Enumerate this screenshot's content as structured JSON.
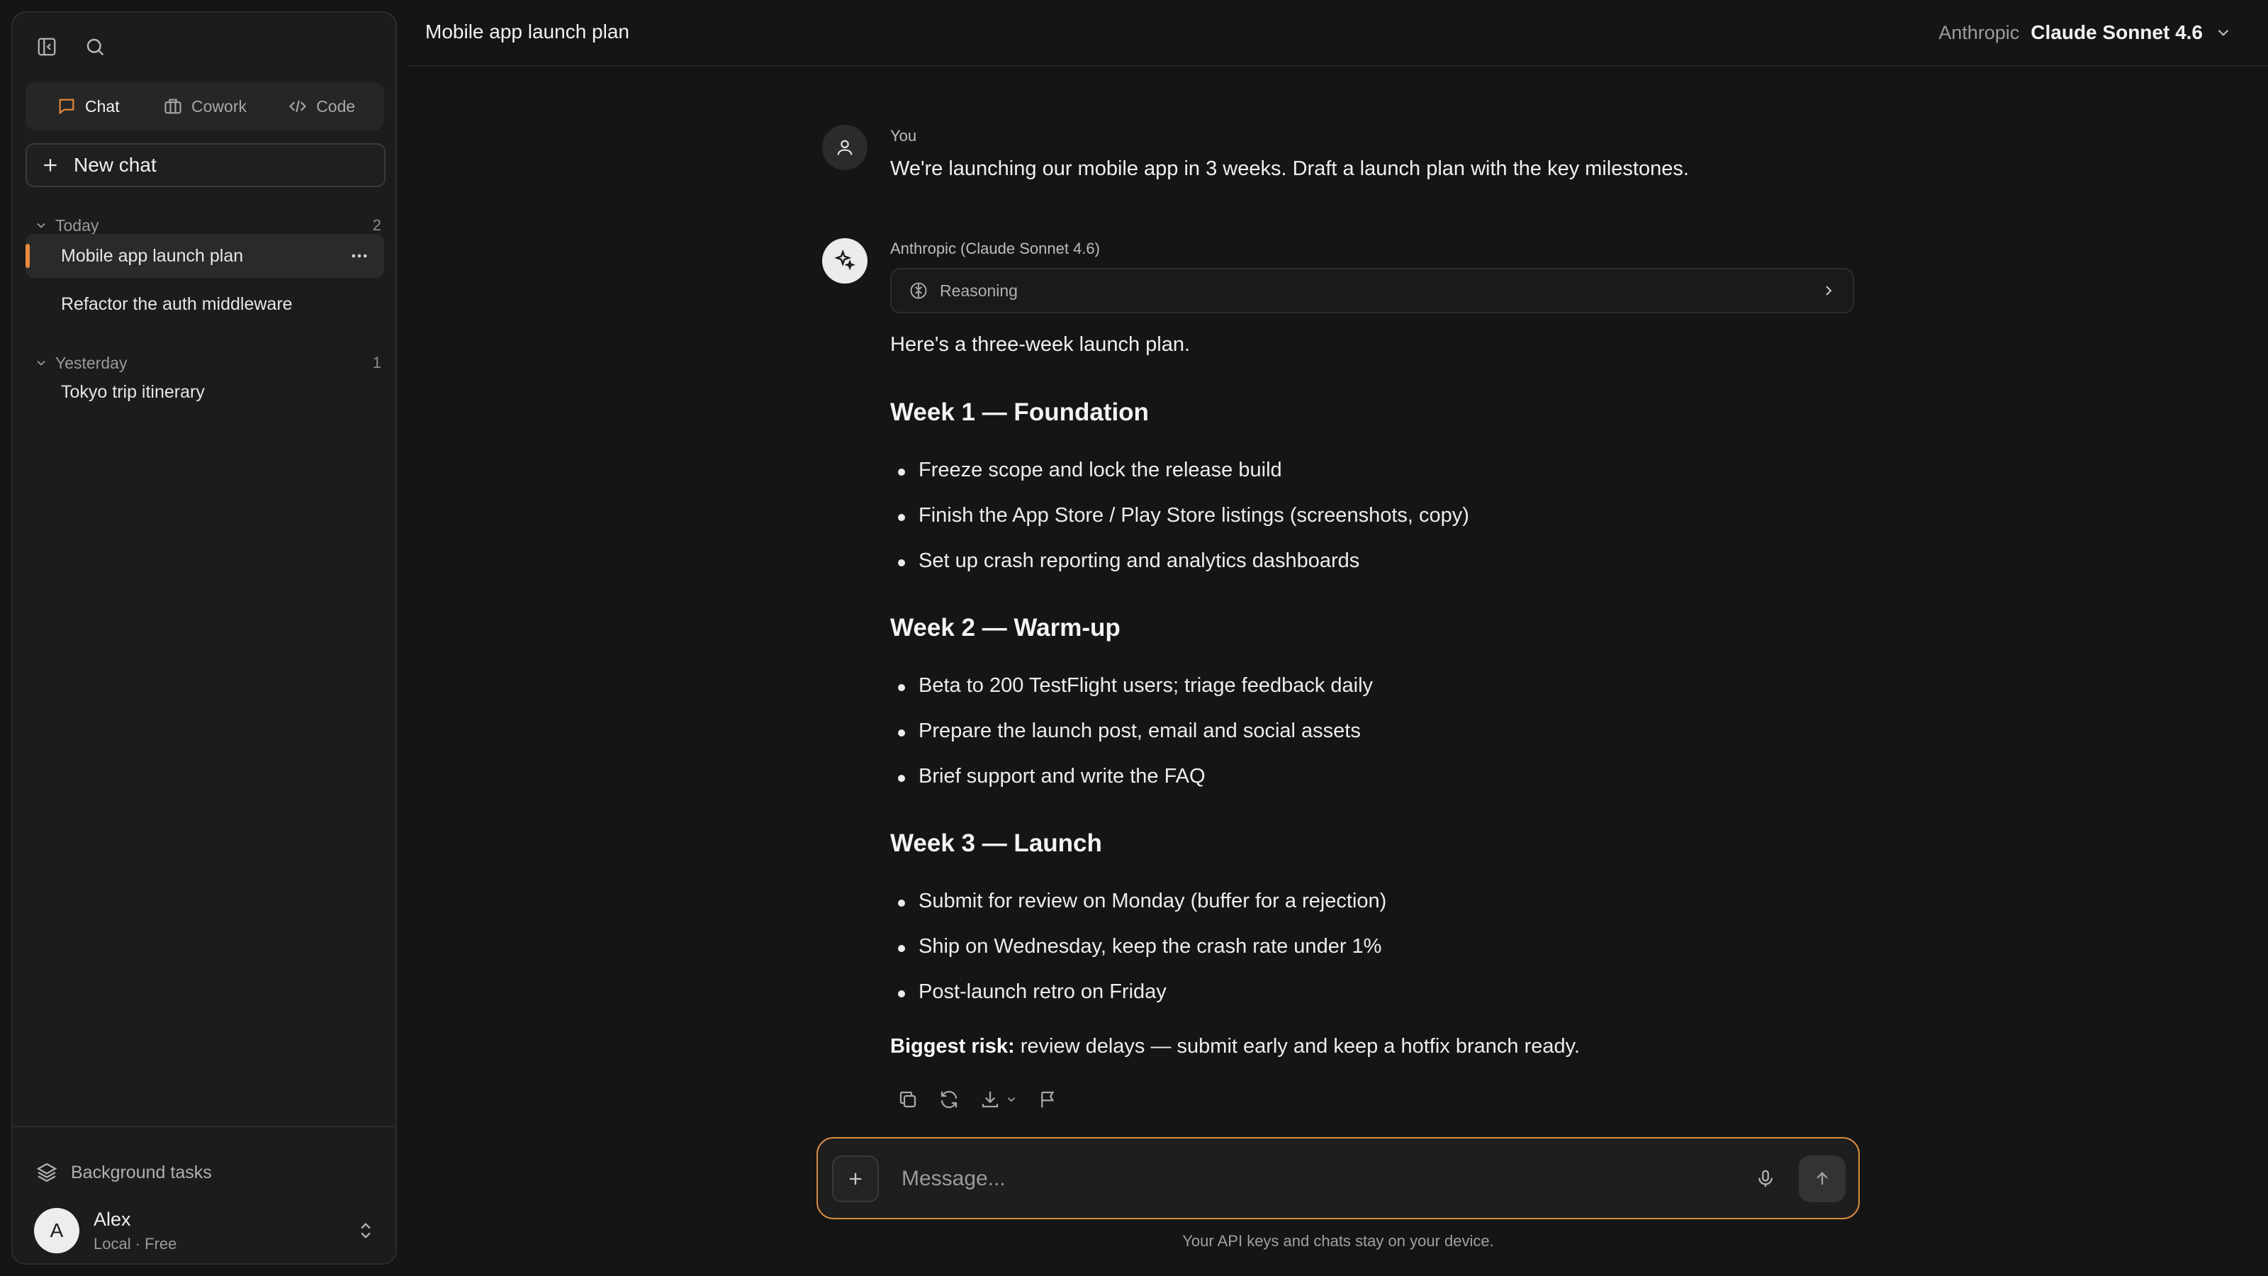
{
  "colors": {
    "background": "#151515",
    "sidebar": "#1c1c1c",
    "accent": "#e98a3c",
    "composer_border": "#d88a43",
    "text_primary": "#f0f0f0",
    "text_muted": "#9a9a9a"
  },
  "sidebar": {
    "toggle_icon": "sidebar-toggle-icon",
    "search_icon": "search-icon",
    "tabs": [
      {
        "label": "Chat",
        "icon": "chat-bubble-icon",
        "active": true
      },
      {
        "label": "Cowork",
        "icon": "briefcase-icon",
        "active": false
      },
      {
        "label": "Code",
        "icon": "code-icon",
        "active": false
      }
    ],
    "new_chat_label": "New chat",
    "groups": [
      {
        "label": "Today",
        "count": "2",
        "items": [
          "Mobile app launch plan",
          "Refactor the auth middleware"
        ]
      },
      {
        "label": "Yesterday",
        "count": "1",
        "items": [
          "Tokyo trip itinerary"
        ]
      }
    ],
    "background_tasks_label": "Background tasks",
    "user": {
      "initial": "A",
      "name": "Alex",
      "plan": "Local · Free"
    }
  },
  "header": {
    "title": "Mobile app launch plan",
    "provider": "Anthropic",
    "model": "Claude Sonnet 4.6"
  },
  "conversation": {
    "user_author": "You",
    "user_message": "We're launching our mobile app in 3 weeks. Draft a launch plan with the key milestones.",
    "assistant_author": "Anthropic (Claude Sonnet 4.6)",
    "reasoning_label": "Reasoning",
    "intro": "Here's a three-week launch plan.",
    "weeks": [
      {
        "title": "Week 1 — Foundation",
        "items": [
          "Freeze scope and lock the release build",
          "Finish the App Store / Play Store listings (screenshots, copy)",
          "Set up crash reporting and analytics dashboards"
        ]
      },
      {
        "title": "Week 2 — Warm-up",
        "items": [
          "Beta to 200 TestFlight users; triage feedback daily",
          "Prepare the launch post, email and social assets",
          "Brief support and write the FAQ"
        ]
      },
      {
        "title": "Week 3 — Launch",
        "items": [
          "Submit for review on Monday (buffer for a rejection)",
          "Ship on Wednesday, keep the crash rate under 1%",
          "Post-launch retro on Friday"
        ]
      }
    ],
    "risk_label": "Biggest risk:",
    "risk_text": " review delays — submit early and keep a hotfix branch ready."
  },
  "composer": {
    "placeholder": "Message...",
    "footer_note": "Your API keys and chats stay on your device."
  }
}
